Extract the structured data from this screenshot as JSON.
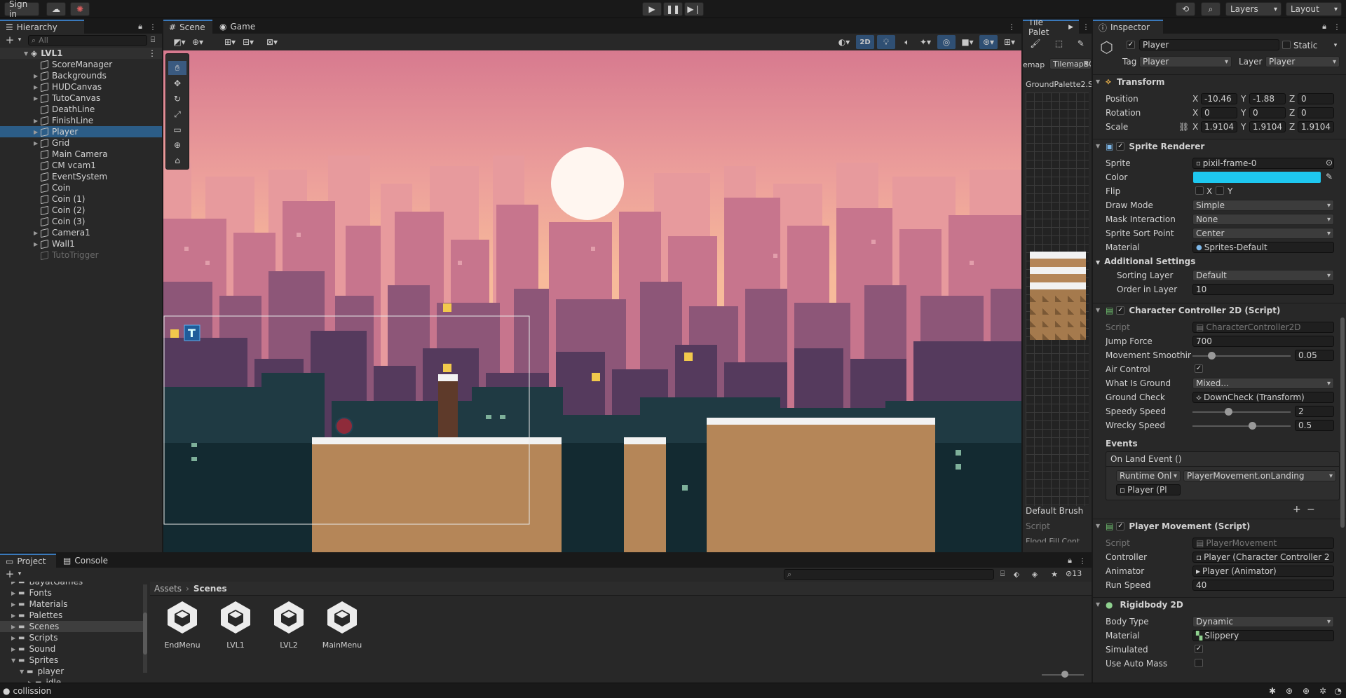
{
  "toolbar": {
    "sign_in": "Sign in",
    "layers": "Layers",
    "layout": "Layout"
  },
  "hierarchy": {
    "tab": "Hierarchy",
    "search_placeholder": "All",
    "scene": "LVL1",
    "items": [
      {
        "label": "ScoreManager",
        "exp": false
      },
      {
        "label": "Backgrounds",
        "exp": true
      },
      {
        "label": "HUDCanvas",
        "exp": true
      },
      {
        "label": "TutoCanvas",
        "exp": true
      },
      {
        "label": "DeathLine",
        "exp": false
      },
      {
        "label": "FinishLine",
        "exp": true
      },
      {
        "label": "Player",
        "exp": true,
        "sel": true
      },
      {
        "label": "Grid",
        "exp": true
      },
      {
        "label": "Main Camera",
        "exp": false
      },
      {
        "label": "CM vcam1",
        "exp": false
      },
      {
        "label": "EventSystem",
        "exp": false
      },
      {
        "label": "Coin",
        "exp": false
      },
      {
        "label": "Coin (1)",
        "exp": false
      },
      {
        "label": "Coin (2)",
        "exp": false
      },
      {
        "label": "Coin (3)",
        "exp": false
      },
      {
        "label": "Camera1",
        "exp": true
      },
      {
        "label": "Wall1",
        "exp": true
      },
      {
        "label": "TutoTrigger",
        "exp": false,
        "dim": true
      }
    ]
  },
  "scene": {
    "tab_scene": "Scene",
    "tab_game": "Game",
    "mode_2d": "2D"
  },
  "tile_palette": {
    "tab": "Tile Palet",
    "map_label": "emap",
    "tilemap": "TilemapBG",
    "palette": "GroundPalette2.S",
    "default_brush": "Default Brush",
    "script": "Script",
    "flood": "Flood Fill Cont"
  },
  "inspector": {
    "tab": "Inspector",
    "name": "Player",
    "static": "Static",
    "tag_label": "Tag",
    "tag": "Player",
    "layer_label": "Layer",
    "layer": "Player",
    "transform": {
      "title": "Transform",
      "position_label": "Position",
      "rotation_label": "Rotation",
      "scale_label": "Scale",
      "pos": [
        "-10.46",
        "-1.88",
        "0"
      ],
      "rot": [
        "0",
        "0",
        "0"
      ],
      "scale": [
        "1.9104",
        "1.9104",
        "1.9104"
      ]
    },
    "sprite_renderer": {
      "title": "Sprite Renderer",
      "sprite_label": "Sprite",
      "sprite": "pixil-frame-0",
      "color_label": "Color",
      "color": "#1ec8f0",
      "flip_label": "Flip",
      "draw_mode_label": "Draw Mode",
      "draw_mode": "Simple",
      "mask_label": "Mask Interaction",
      "mask": "None",
      "sort_point_label": "Sprite Sort Point",
      "sort_point": "Center",
      "material_label": "Material",
      "material": "Sprites-Default",
      "additional": "Additional Settings",
      "sorting_layer_label": "Sorting Layer",
      "sorting_layer": "Default",
      "order_label": "Order in Layer",
      "order": "10"
    },
    "cc2d": {
      "title": "Character Controller 2D (Script)",
      "script_label": "Script",
      "script": "CharacterController2D",
      "jump_label": "Jump Force",
      "jump": "700",
      "smooth_label": "Movement Smoothing",
      "smooth": "0.05",
      "air_label": "Air Control",
      "ground_label": "What Is Ground",
      "ground": "Mixed...",
      "gcheck_label": "Ground Check",
      "gcheck": "DownCheck (Transform)",
      "speedy_label": "Speedy Speed",
      "speedy": "2",
      "wrecky_label": "Wrecky Speed",
      "wrecky": "0.5",
      "events": "Events",
      "on_land": "On Land Event ()",
      "runtime": "Runtime Onl",
      "method": "PlayerMovement.onLanding",
      "obj": "Player (Pl"
    },
    "pm": {
      "title": "Player Movement (Script)",
      "script_label": "Script",
      "script": "PlayerMovement",
      "controller_label": "Controller",
      "controller": "Player (Character Controller 2",
      "animator_label": "Animator",
      "animator": "Player (Animator)",
      "run_label": "Run Speed",
      "run": "40"
    },
    "rb": {
      "title": "Rigidbody 2D",
      "body_label": "Body Type",
      "body": "Dynamic",
      "material_label": "Material",
      "material": "Slippery",
      "simulated_label": "Simulated",
      "auto_mass_label": "Use Auto Mass"
    }
  },
  "project": {
    "tab_project": "Project",
    "tab_console": "Console",
    "breadcrumb_assets": "Assets",
    "breadcrumb_scenes": "Scenes",
    "hidden_count": "13",
    "folders": [
      {
        "label": "BayatGames",
        "depth": 1
      },
      {
        "label": "Fonts",
        "depth": 1
      },
      {
        "label": "Materials",
        "depth": 1
      },
      {
        "label": "Palettes",
        "depth": 1
      },
      {
        "label": "Scenes",
        "depth": 1,
        "sel": true
      },
      {
        "label": "Scripts",
        "depth": 1
      },
      {
        "label": "Sound",
        "depth": 1
      },
      {
        "label": "Sprites",
        "depth": 1,
        "open": true
      },
      {
        "label": "player",
        "depth": 2,
        "open": true
      },
      {
        "label": "idle",
        "depth": 3
      }
    ],
    "assets": [
      {
        "label": "EndMenu"
      },
      {
        "label": "LVL1"
      },
      {
        "label": "LVL2"
      },
      {
        "label": "MainMenu"
      }
    ]
  },
  "status": {
    "text": "collission"
  },
  "colors": {
    "accent": "#3a79bb",
    "selection": "#2c5d87",
    "sky_top": "#e88e8e",
    "sky_bottom": "#f7b896",
    "ground": "#b58658",
    "snow": "#f2f2f2"
  }
}
